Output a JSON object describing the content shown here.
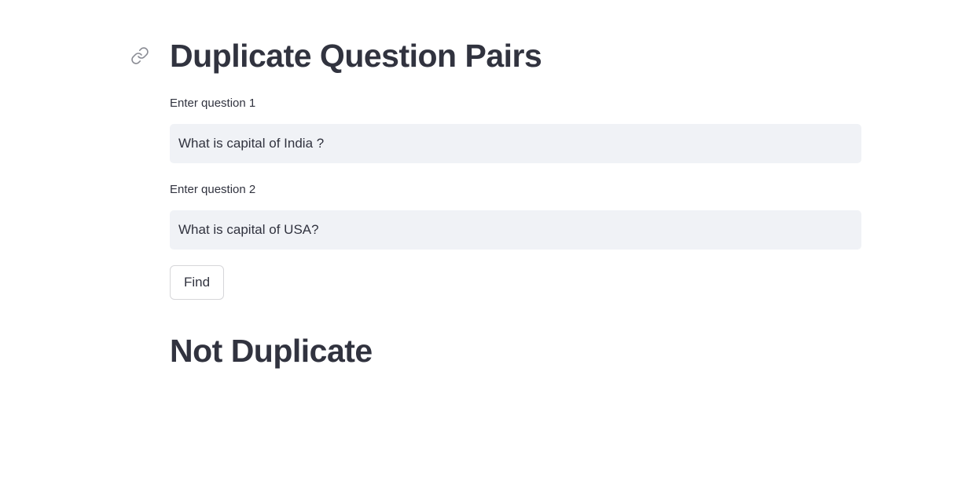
{
  "page": {
    "title": "Duplicate Question Pairs",
    "anchor_icon": "link-icon"
  },
  "form": {
    "question1": {
      "label": "Enter question 1",
      "value": "What is capital of India ?"
    },
    "question2": {
      "label": "Enter question 2",
      "value": "What is capital of USA?"
    },
    "submit_label": "Find"
  },
  "result": {
    "text": "Not Duplicate"
  },
  "colors": {
    "text": "#31333f",
    "input_background": "#f0f2f6",
    "button_border": "#d6d6d9",
    "icon": "#8a8c94"
  }
}
